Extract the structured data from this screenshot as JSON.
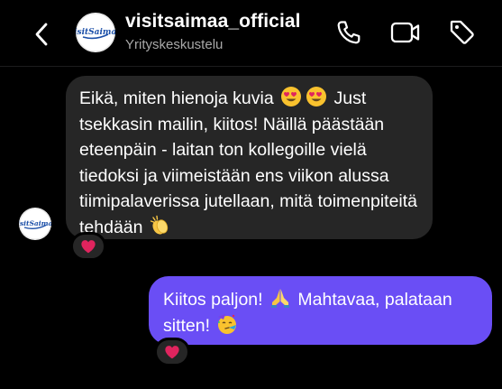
{
  "header": {
    "title": "visitsaimaa_official",
    "subtitle": "Yrityskeskustelu",
    "avatar_logo_text": "visitSaimaa",
    "icons": [
      "back-chevron-icon",
      "phone-icon",
      "video-camera-icon",
      "tag-icon"
    ]
  },
  "messages": [
    {
      "direction": "incoming",
      "parts": [
        "Eikä, miten hienoja kuvia ",
        " Just tsekkasin mailin, kiitos! Näillä päästään eteenpäin - laitan ton kollegoille vielä tiedoksi ja viimeistään ens viikon alussa tiimipalaverissa jutellaan, mitä toimenpiteitä tehdään "
      ],
      "emojis": [
        "heart-eyes-emoji",
        "heart-eyes-emoji",
        "clapping-hands-emoji"
      ],
      "reaction": "red-heart-emoji"
    },
    {
      "direction": "outgoing",
      "parts": [
        "Kiitos paljon! ",
        " Mahtavaa, palataan sitten! "
      ],
      "emojis": [
        "folded-hands-emoji",
        "partying-face-emoji"
      ],
      "reaction": "red-heart-emoji"
    }
  ],
  "colors": {
    "background": "#000000",
    "incoming_bubble": "#262626",
    "outgoing_bubble": "#6a4ef5",
    "subtitle": "#a8a8a8",
    "heart": "#e0245e"
  }
}
